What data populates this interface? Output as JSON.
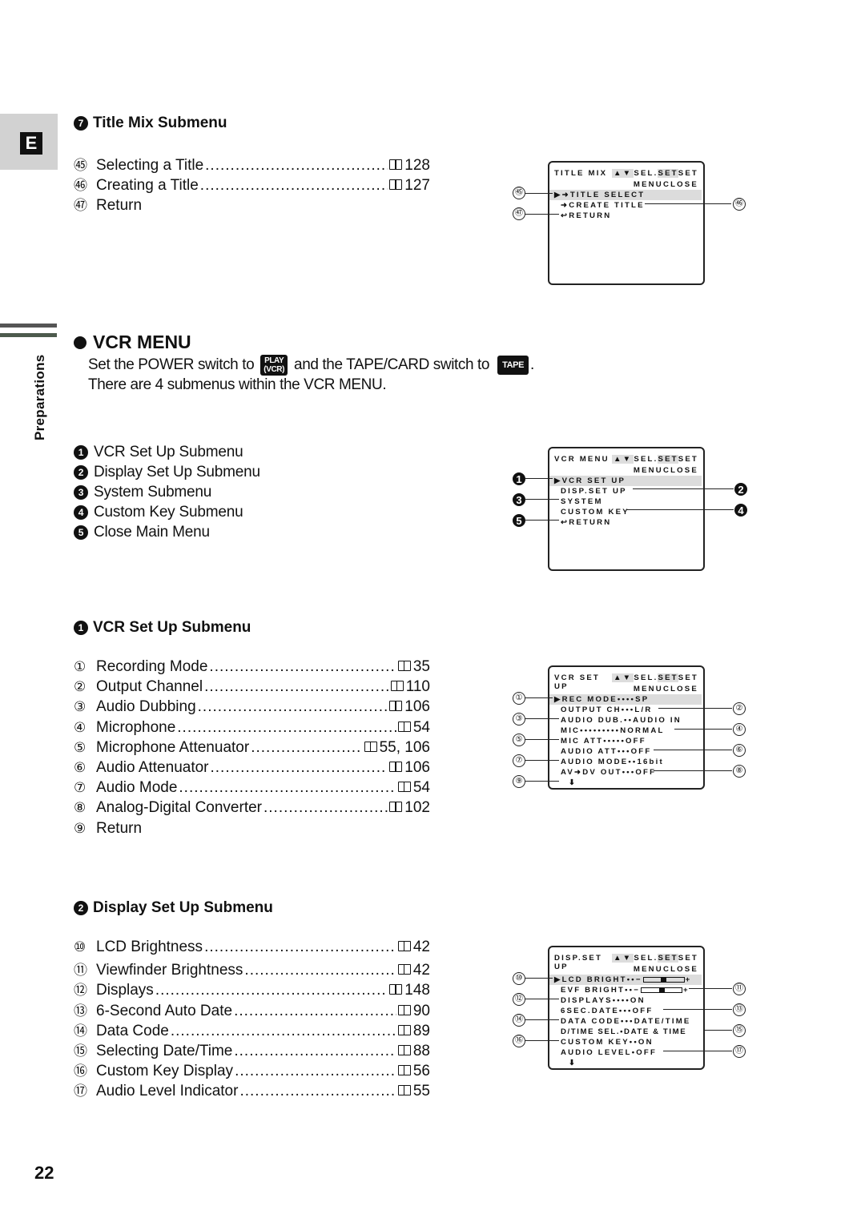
{
  "page_number": "22",
  "side_tab": {
    "language_letter": "E",
    "section_label": "Preparations"
  },
  "title_mix": {
    "heading_num": "7",
    "heading": "Title Mix Submenu",
    "items": [
      {
        "num": "㊺",
        "label": "Selecting a Title",
        "page": "128"
      },
      {
        "num": "㊻",
        "label": "Creating a Title",
        "page": "127"
      },
      {
        "num": "㊼",
        "label": "Return",
        "page": ""
      }
    ],
    "screen": {
      "title": "TITLE MIX",
      "nav": "▲▼",
      "sel": "SEL.",
      "set_key": "SET",
      "set": "SET",
      "menu_key": "MENU",
      "close": "CLOSE",
      "lines": [
        "▶➜TITLE SELECT",
        "➜CREATE TITLE",
        "↩RETURN"
      ],
      "callouts": [
        "㊺",
        "㊻",
        "㊼"
      ]
    }
  },
  "vcr_menu": {
    "heading": "VCR MENU",
    "line1_a": "Set the POWER switch to",
    "play_badge_top": "PLAY",
    "play_badge_bottom": "(VCR)",
    "line1_b": "and the TAPE/CARD switch to",
    "tape_badge": "TAPE",
    "line1_end": ".",
    "line2": "There are 4 submenus within the VCR MENU.",
    "items": [
      {
        "num": "1",
        "label": "VCR Set Up Submenu"
      },
      {
        "num": "2",
        "label": "Display Set Up Submenu"
      },
      {
        "num": "3",
        "label": "System Submenu"
      },
      {
        "num": "4",
        "label": "Custom Key Submenu"
      },
      {
        "num": "5",
        "label": "Close Main Menu"
      }
    ],
    "screen": {
      "title": "VCR MENU",
      "nav": "▲▼",
      "sel": "SEL.",
      "set_key": "SET",
      "set": "SET",
      "menu_key": "MENU",
      "close": "CLOSE",
      "lines": [
        "▶VCR SET UP",
        "DISP.SET UP",
        "SYSTEM",
        "CUSTOM KEY",
        "↩RETURN"
      ],
      "callouts": [
        "1",
        "2",
        "3",
        "4",
        "5"
      ]
    }
  },
  "vcr_setup": {
    "heading_num": "1",
    "heading": "VCR Set Up Submenu",
    "items": [
      {
        "num": "①",
        "label": "Recording Mode",
        "page": "35"
      },
      {
        "num": "②",
        "label": "Output Channel",
        "page": "110"
      },
      {
        "num": "③",
        "label": "Audio Dubbing",
        "page": "106"
      },
      {
        "num": "④",
        "label": "Microphone",
        "page": "54"
      },
      {
        "num": "⑤",
        "label": "Microphone Attenuator",
        "page": "55, 106"
      },
      {
        "num": "⑥",
        "label": "Audio Attenuator",
        "page": "106"
      },
      {
        "num": "⑦",
        "label": "Audio Mode",
        "page": "54"
      },
      {
        "num": "⑧",
        "label": "Analog-Digital Converter",
        "page": "102"
      },
      {
        "num": "⑨",
        "label": "Return",
        "page": ""
      }
    ],
    "screen": {
      "title": "VCR SET UP",
      "nav": "▲▼",
      "sel": "SEL.",
      "set_key": "SET",
      "set": "SET",
      "menu_key": "MENU",
      "close": "CLOSE",
      "lines": [
        "▶REC MODE••••SP",
        "OUTPUT CH•••L/R",
        "AUDIO DUB.••AUDIO IN",
        "MIC•••••••••NORMAL",
        "MIC ATT•••••OFF",
        "AUDIO ATT•••OFF",
        "AUDIO MODE••16bit",
        "AV➜DV OUT•••OFF",
        "⬇"
      ],
      "callouts": [
        "①",
        "②",
        "③",
        "④",
        "⑤",
        "⑥",
        "⑦",
        "⑧",
        "⑨"
      ]
    }
  },
  "disp_setup": {
    "heading_num": "2",
    "heading": "Display Set Up Submenu",
    "items": [
      {
        "num": "⑩",
        "label": "LCD Brightness",
        "page": "42"
      },
      {
        "num": "⑪",
        "label": "Viewfinder Brightness",
        "page": "42"
      },
      {
        "num": "⑫",
        "label": "Displays",
        "page": "148"
      },
      {
        "num": "⑬",
        "label": "6-Second Auto Date",
        "page": "90"
      },
      {
        "num": "⑭",
        "label": "Data Code",
        "page": "89"
      },
      {
        "num": "⑮",
        "label": "Selecting Date/Time",
        "page": "88"
      },
      {
        "num": "⑯",
        "label": "Custom Key Display",
        "page": "56"
      },
      {
        "num": "⑰",
        "label": "Audio Level Indicator",
        "page": "55"
      }
    ],
    "screen": {
      "title": "DISP.SET UP",
      "nav": "▲▼",
      "sel": "SEL.",
      "set_key": "SET",
      "set": "SET",
      "menu_key": "MENU",
      "close": "CLOSE",
      "lcd_label": "▶LCD BRIGHT••−",
      "evf_label": "EVF BRIGHT••−",
      "slider_plus": "+",
      "lcd_level": 0.5,
      "evf_level": 0.5,
      "lines": [
        "DISPLAYS••••ON",
        "6SEC.DATE•••OFF",
        "DATA CODE•••DATE/TIME",
        "D/TIME SEL.•DATE & TIME",
        "CUSTOM KEY••ON",
        "AUDIO LEVEL•OFF",
        "⬇"
      ],
      "callouts": [
        "⑩",
        "⑪",
        "⑫",
        "⑬",
        "⑭",
        "⑮",
        "⑯",
        "⑰"
      ]
    }
  }
}
